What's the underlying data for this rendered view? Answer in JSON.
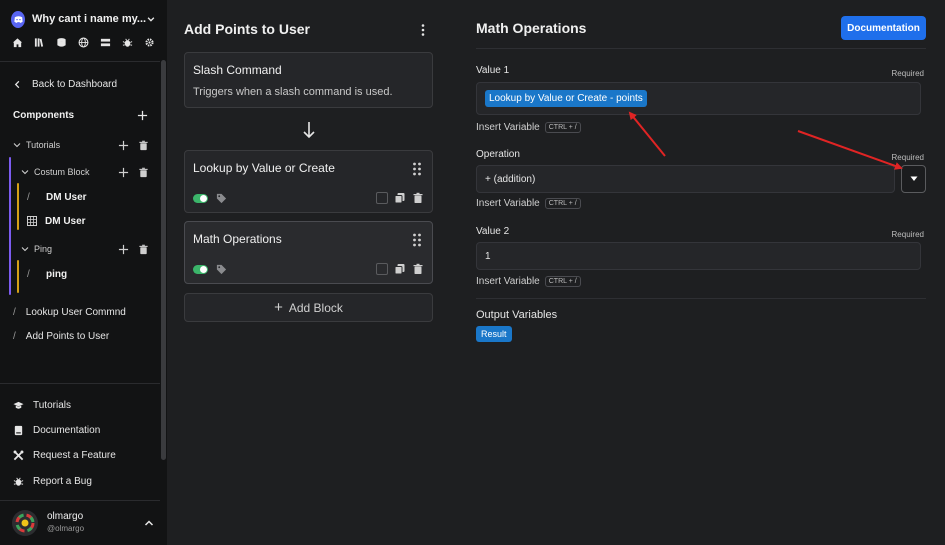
{
  "sidebar": {
    "server_name": "Why cant i name my...",
    "back_label": "Back to Dashboard",
    "components_label": "Components",
    "tree": {
      "tutorials": "Tutorials",
      "costum_block": "Costum Block",
      "dm_user_1": "DM User",
      "dm_user_2": "DM User",
      "ping_folder": "Ping",
      "ping_cmd": "ping",
      "lookup_cmd": "Lookup User Commnd",
      "add_points_cmd": "Add Points to User"
    },
    "bottom": {
      "tutorials": "Tutorials",
      "documentation": "Documentation",
      "request": "Request a Feature",
      "bug": "Report a Bug"
    },
    "user": {
      "name": "olmargo",
      "handle": "@olmargo"
    }
  },
  "middle": {
    "title": "Add Points to User",
    "trigger": {
      "title": "Slash Command",
      "subtitle": "Triggers when a slash command is used."
    },
    "blocks": [
      {
        "title": "Lookup by Value or Create"
      },
      {
        "title": "Math Operations"
      }
    ],
    "add_block": "Add Block"
  },
  "panel": {
    "title": "Math Operations",
    "doc_button": "Documentation",
    "required": "Required",
    "insert_variable": "Insert Variable",
    "shortcut": "CTRL + /",
    "value1": {
      "label": "Value 1",
      "chip": "Lookup by Value or Create - points"
    },
    "operation": {
      "label": "Operation",
      "value": "+ (addition)"
    },
    "value2": {
      "label": "Value 2",
      "value": "1"
    },
    "output_label": "Output Variables",
    "output_chip": "Result"
  },
  "colors": {
    "accent": "#1f6feb",
    "chip": "#1a77c9",
    "toggle_on": "#3bb56a",
    "annotation": "#e02424"
  }
}
